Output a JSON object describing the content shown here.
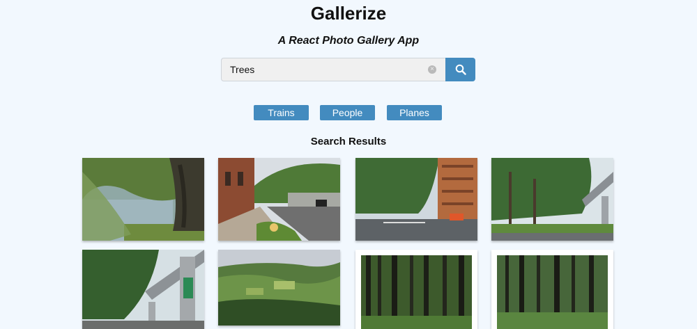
{
  "header": {
    "title": "Gallerize",
    "subtitle": "A React Photo Gallery App"
  },
  "search": {
    "value": "Trees",
    "clear_icon": "clear-x-icon",
    "button_icon": "magnifier-icon"
  },
  "nav": {
    "items": [
      {
        "label": "Trains"
      },
      {
        "label": "People"
      },
      {
        "label": "Planes"
      }
    ]
  },
  "results": {
    "title": "Search Results",
    "photos": [
      {
        "subject": "willow tree by water"
      },
      {
        "subject": "tree-lined city street"
      },
      {
        "subject": "street intersection with trees"
      },
      {
        "subject": "park trees near monorail"
      },
      {
        "subject": "trees under monorail track"
      },
      {
        "subject": "green hills landscape"
      },
      {
        "subject": "dark forest trunks"
      },
      {
        "subject": "forest trunks"
      }
    ]
  },
  "colors": {
    "background": "#f2f8fe",
    "accent": "#438bbf"
  }
}
